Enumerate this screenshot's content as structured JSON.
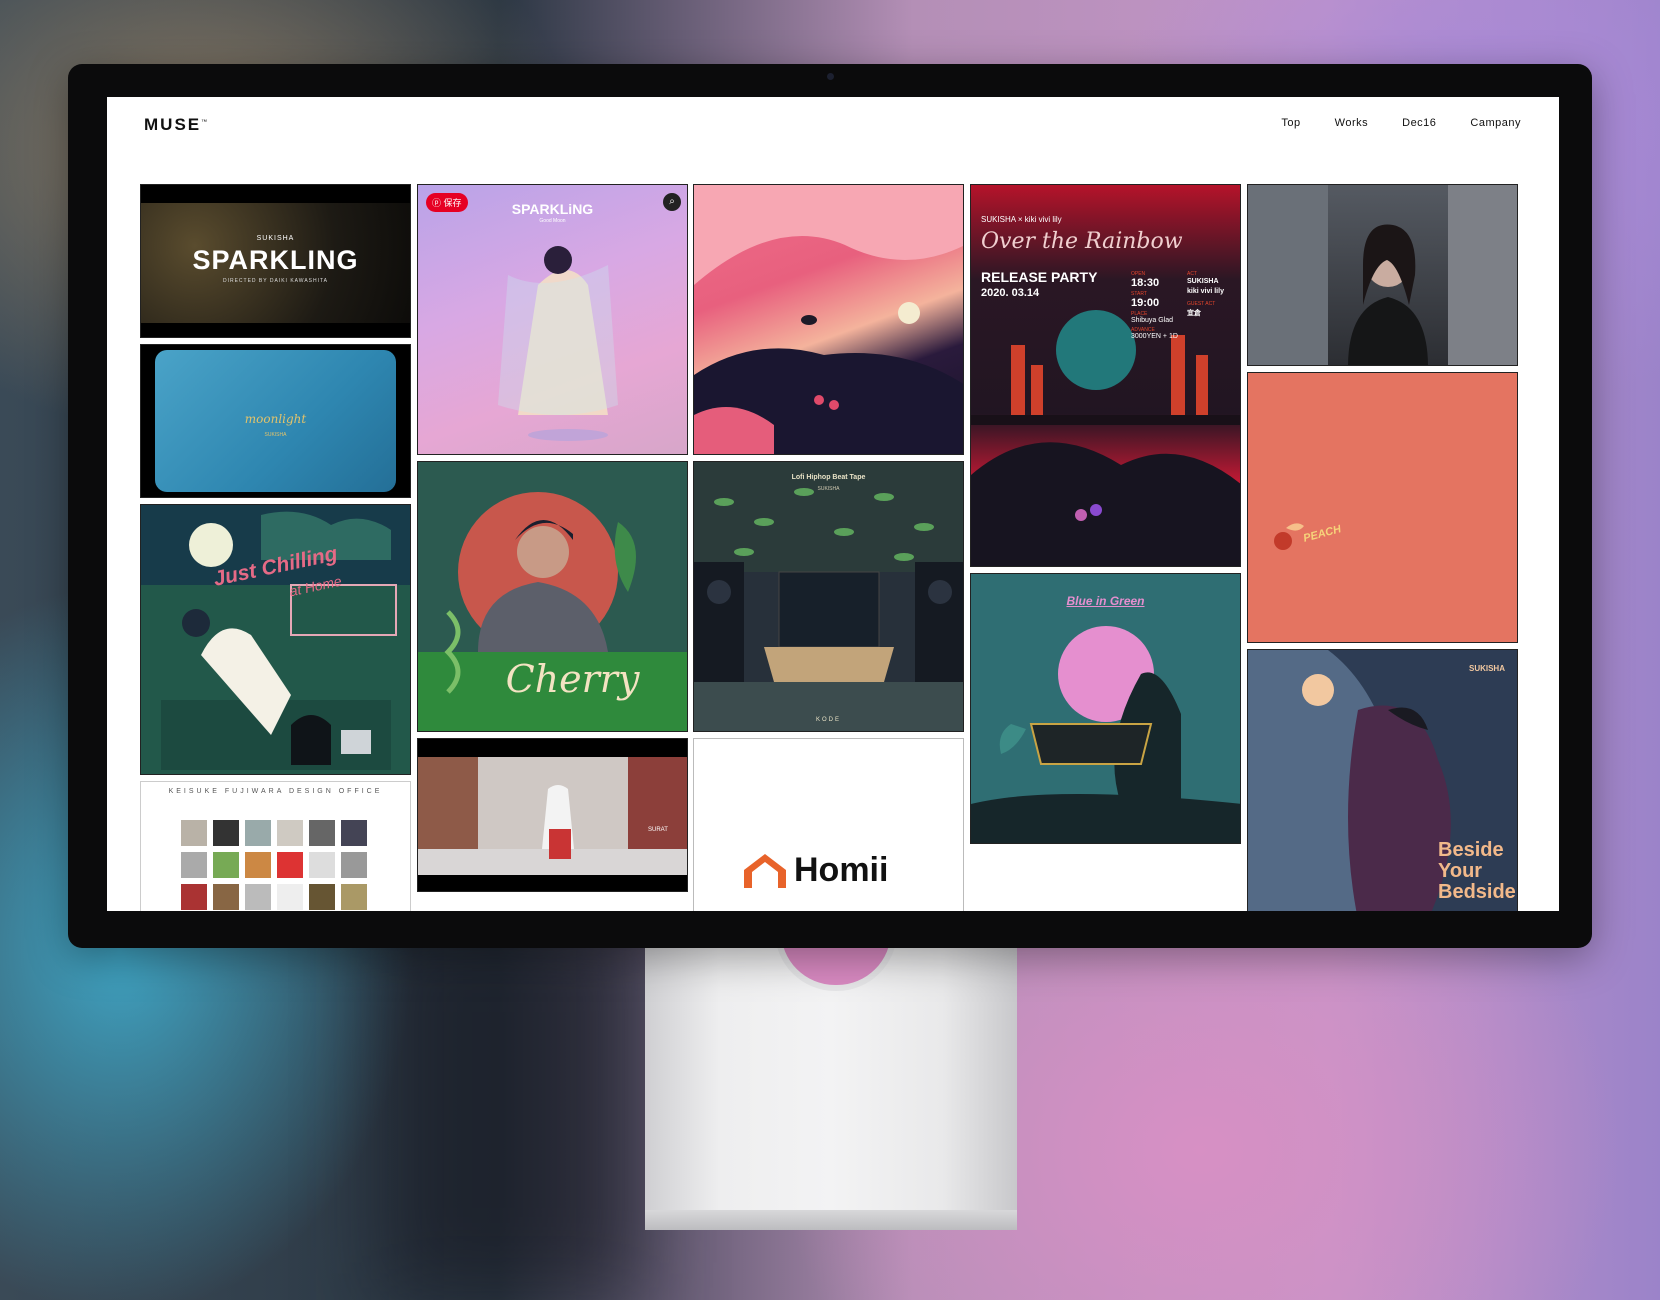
{
  "site": {
    "logo": "MUSE",
    "logo_tm": "™",
    "nav": [
      "Top",
      "Works",
      "Dec16",
      "Campany"
    ]
  },
  "works": {
    "sparkling_video": {
      "artist": "SUKISHA",
      "title": "SPARKLING",
      "credit": "DIRECTED BY DAIKI KAWASHITA"
    },
    "moonlight": {
      "title": "moonlight",
      "artist": "SUKISHA"
    },
    "just_chilling": {
      "title": "Just Chilling",
      "subtitle": "at Home"
    },
    "design_office": {
      "title": "KEISUKE FUJIWARA DESIGN OFFICE"
    },
    "sparkling_cover": {
      "title": "SPARKLiNG",
      "subtitle": "Good Moon",
      "save_badge": "保存"
    },
    "cherry": {
      "title": "Cherry"
    },
    "street": {
      "sign": "SURAT"
    },
    "over_rainbow_art": {
      "title": "Over the Rainbow"
    },
    "lofi": {
      "title": "Lofi Hiphop Beat Tape",
      "artist": "SUKISHA",
      "footer": "KODE"
    },
    "homii": {
      "brand": "Homii"
    },
    "release_party": {
      "header": "SUKISHA × kiki vivi lily",
      "script": "Over the Rainbow",
      "title": "RELEASE PARTY",
      "date": "2020. 03.14",
      "open_label": "OPEN",
      "open_time": "18:30",
      "start_label": "START",
      "start_time": "19:00",
      "place_label": "PLACE",
      "place": "Shibuya Glad",
      "advance_label": "ADVANCE",
      "advance": "3000YEN + 1D",
      "act_label": "ACT",
      "act1": "SUKISHA",
      "act2": "kiki vivi lily",
      "guest_label": "GUEST ACT",
      "guest": "宜倉"
    },
    "blue_in_green": {
      "title": "Blue in Green"
    },
    "peach": {
      "title": "PEACH"
    },
    "beside": {
      "artist": "SUKISHA",
      "title_l1": "Beside",
      "title_l2": "Your",
      "title_l3": "Bedside"
    }
  }
}
